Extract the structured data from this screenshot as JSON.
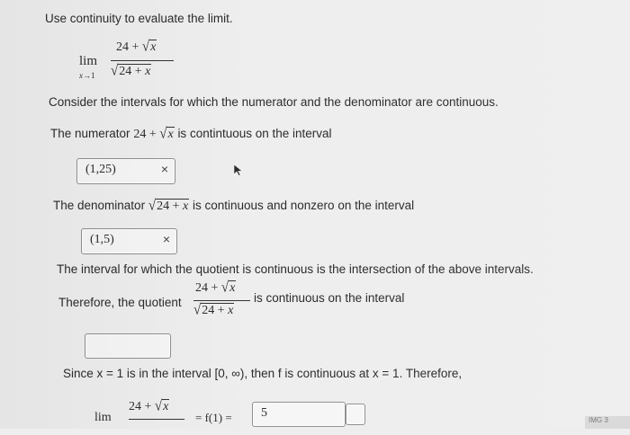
{
  "instruction": "Use continuity to evaluate the limit.",
  "lim_word": "lim",
  "lim_sub": "x→1",
  "expr_num": "24 + √x",
  "expr_den": "√24 + x",
  "step1": "Consider the intervals for which the numerator and the denominator are continuous.",
  "numerator": {
    "text_before": "The numerator",
    "expr": "24 + √x",
    "text_after": "is contintuous on the interval",
    "answer": "(1,25)",
    "status": "incorrect"
  },
  "denominator": {
    "text_before": "The denominator",
    "expr": "√24 + x",
    "text_after": "is continuous and nonzero on the interval",
    "answer": "(1,5)",
    "status": "incorrect"
  },
  "intersection_text": "The interval for which the quotient is continuous is the intersection of the above intervals.",
  "quotient": {
    "text_before": "Therefore, the quotient",
    "text_after": "is continuous on the interval",
    "answer": ""
  },
  "since": {
    "text": "Since x = 1 is in the interval [0, ∞), then f is continuous at x = 1. Therefore,"
  },
  "final": {
    "lim_word": "lim",
    "eq": "= f(1) =",
    "answer": "5"
  },
  "x_mark": "×",
  "corner_text": "IMG 3"
}
